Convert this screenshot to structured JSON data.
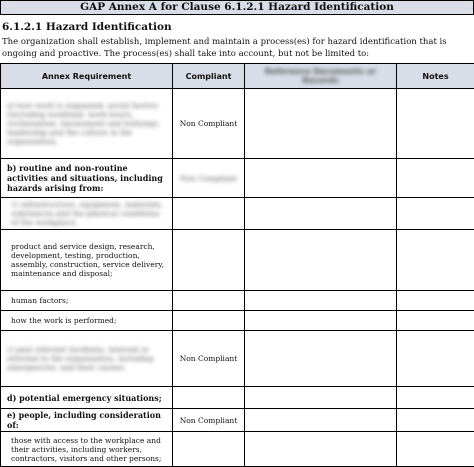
{
  "title": "GAP Annex A for Clause 6.1.2.1 Hazard Identification",
  "heading": "6.1.2.1 Hazard Identification",
  "intro": "The organization shall establish, implement and maintain a process(es) for hazard identification that is ongoing and proactive. The process(es) shall take into account, but not be limited to:",
  "columns": [
    "Annex Requirement",
    "Compliant",
    "Reference Documents or Records",
    "Notes"
  ],
  "rows": [
    {
      "requirement": "a) how work is organized, social factors (including workload, work hours, victimization, harassment and bullying), leadership and the culture in the organization;",
      "compliant": "Non Compliant",
      "req_blurred": true,
      "comp_blurred": false,
      "style": "plain"
    },
    {
      "requirement": "b) routine and non-routine activities and situations, including hazards arising from:",
      "compliant": "Non Compliant",
      "req_blurred": false,
      "comp_blurred": true,
      "style": "bold"
    },
    {
      "requirement": "1) infrastructure, equipment, materials, substances and the physical conditions of the workplace;",
      "compliant": "",
      "req_blurred": true,
      "comp_blurred": false,
      "style": "indent"
    },
    {
      "requirement": "product and service design, research, development, testing, production, assembly, construction, service delivery, maintenance and disposal;",
      "compliant": "",
      "req_blurred": false,
      "comp_blurred": false,
      "style": "indent"
    },
    {
      "requirement": "human factors;",
      "compliant": "",
      "req_blurred": false,
      "comp_blurred": false,
      "style": "indent"
    },
    {
      "requirement": "how the work is performed;",
      "compliant": "",
      "req_blurred": false,
      "comp_blurred": false,
      "style": "indent"
    },
    {
      "requirement": "c) past relevant incidents, internal or external to the organization, including emergencies, and their causes;",
      "compliant": "Non Compliant",
      "req_blurred": true,
      "comp_blurred": false,
      "style": "plain"
    },
    {
      "requirement": "d) potential emergency situations;",
      "compliant": "",
      "req_blurred": false,
      "comp_blurred": false,
      "style": "bold"
    },
    {
      "requirement": "e) people, including consideration of:",
      "compliant": "Non Compliant",
      "req_blurred": false,
      "comp_blurred": false,
      "style": "bold"
    },
    {
      "requirement": "those with access to the workplace and their activities, including workers, contractors, visitors and other persons;",
      "compliant": "",
      "req_blurred": false,
      "comp_blurred": false,
      "style": "indent"
    }
  ]
}
